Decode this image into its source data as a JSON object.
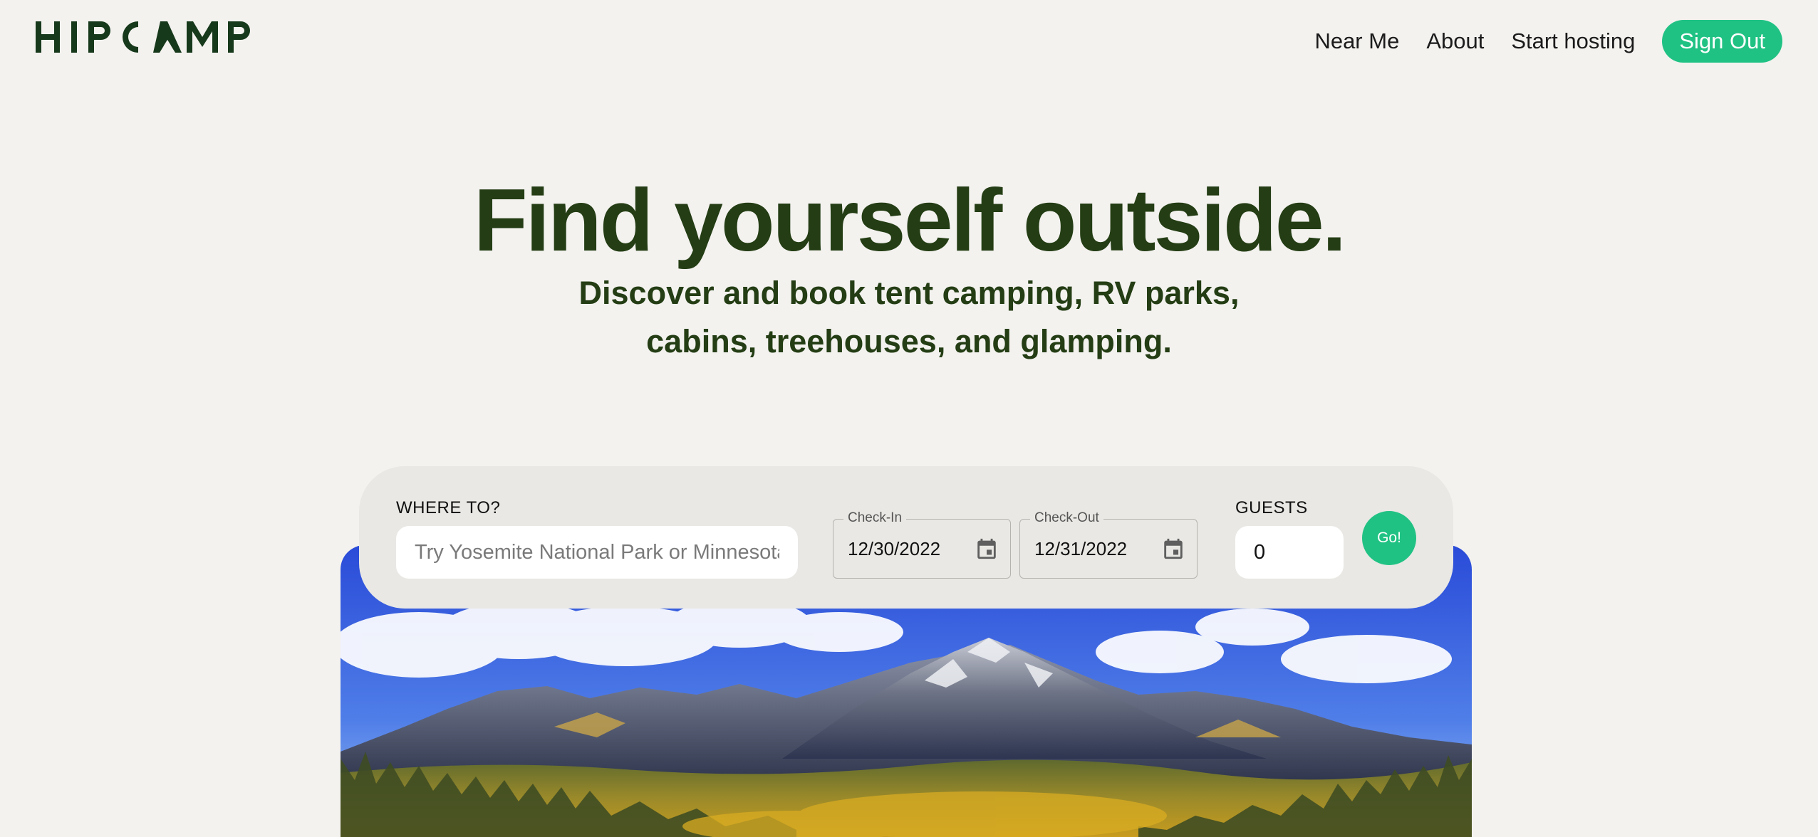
{
  "header": {
    "logo_text": "HIPCAMP",
    "nav": {
      "near_me": "Near Me",
      "about": "About",
      "start_hosting": "Start hosting",
      "sign_out": "Sign Out"
    }
  },
  "hero": {
    "title": "Find yourself outside.",
    "subtitle": "Discover and book tent camping, RV parks, cabins, treehouses, and glamping."
  },
  "search": {
    "where_label": "WHERE TO?",
    "where_placeholder": "Try Yosemite National Park or Minnesota",
    "check_in_label": "Check-In",
    "check_in_value": "12/30/2022",
    "check_out_label": "Check-Out",
    "check_out_value": "12/31/2022",
    "guests_label": "GUESTS",
    "guests_value": "0",
    "go_label": "Go!"
  },
  "colors": {
    "brand_green": "#20c283",
    "heading_green": "#243d14",
    "logo_green": "#17391b",
    "background": "#f3f2ef"
  },
  "icons": {
    "calendar": "calendar-icon"
  }
}
